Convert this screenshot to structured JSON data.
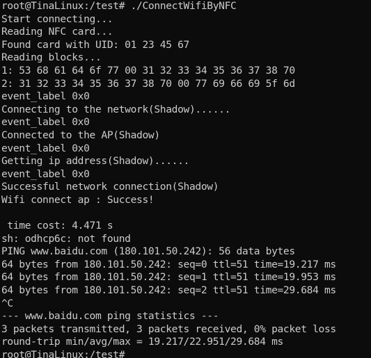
{
  "terminal": {
    "background": "#0c0c0c",
    "foreground": "#cccccc",
    "lines": [
      "root@TinaLinux:/test# ./ConnectWifiByNFC",
      "Start connecting...",
      "Reading NFC card...",
      "Found card with UID: 01 23 45 67",
      "Reading blocks...",
      "1: 53 68 61 64 6f 77 00 31 32 33 34 35 36 37 38 70",
      "2: 31 32 33 34 35 36 37 38 70 00 77 69 66 69 5f 6d",
      "event_label 0x0",
      "Connecting to the network(Shadow)......",
      "event_label 0x0",
      "Connected to the AP(Shadow)",
      "event_label 0x0",
      "Getting ip address(Shadow)......",
      "event_label 0x0",
      "Successful network connection(Shadow)",
      "Wifi connect ap : Success!",
      "",
      " time cost: 4.471 s",
      "sh: odhcp6c: not found",
      "PING www.baidu.com (180.101.50.242): 56 data bytes",
      "64 bytes from 180.101.50.242: seq=0 ttl=51 time=19.217 ms",
      "64 bytes from 180.101.50.242: seq=1 ttl=51 time=19.953 ms",
      "64 bytes from 180.101.50.242: seq=2 ttl=51 time=29.684 ms",
      "^C",
      "--- www.baidu.com ping statistics ---",
      "3 packets transmitted, 3 packets received, 0% packet loss",
      "round-trip min/avg/max = 19.217/22.951/29.684 ms"
    ],
    "prompt": "root@TinaLinux:/test#"
  }
}
